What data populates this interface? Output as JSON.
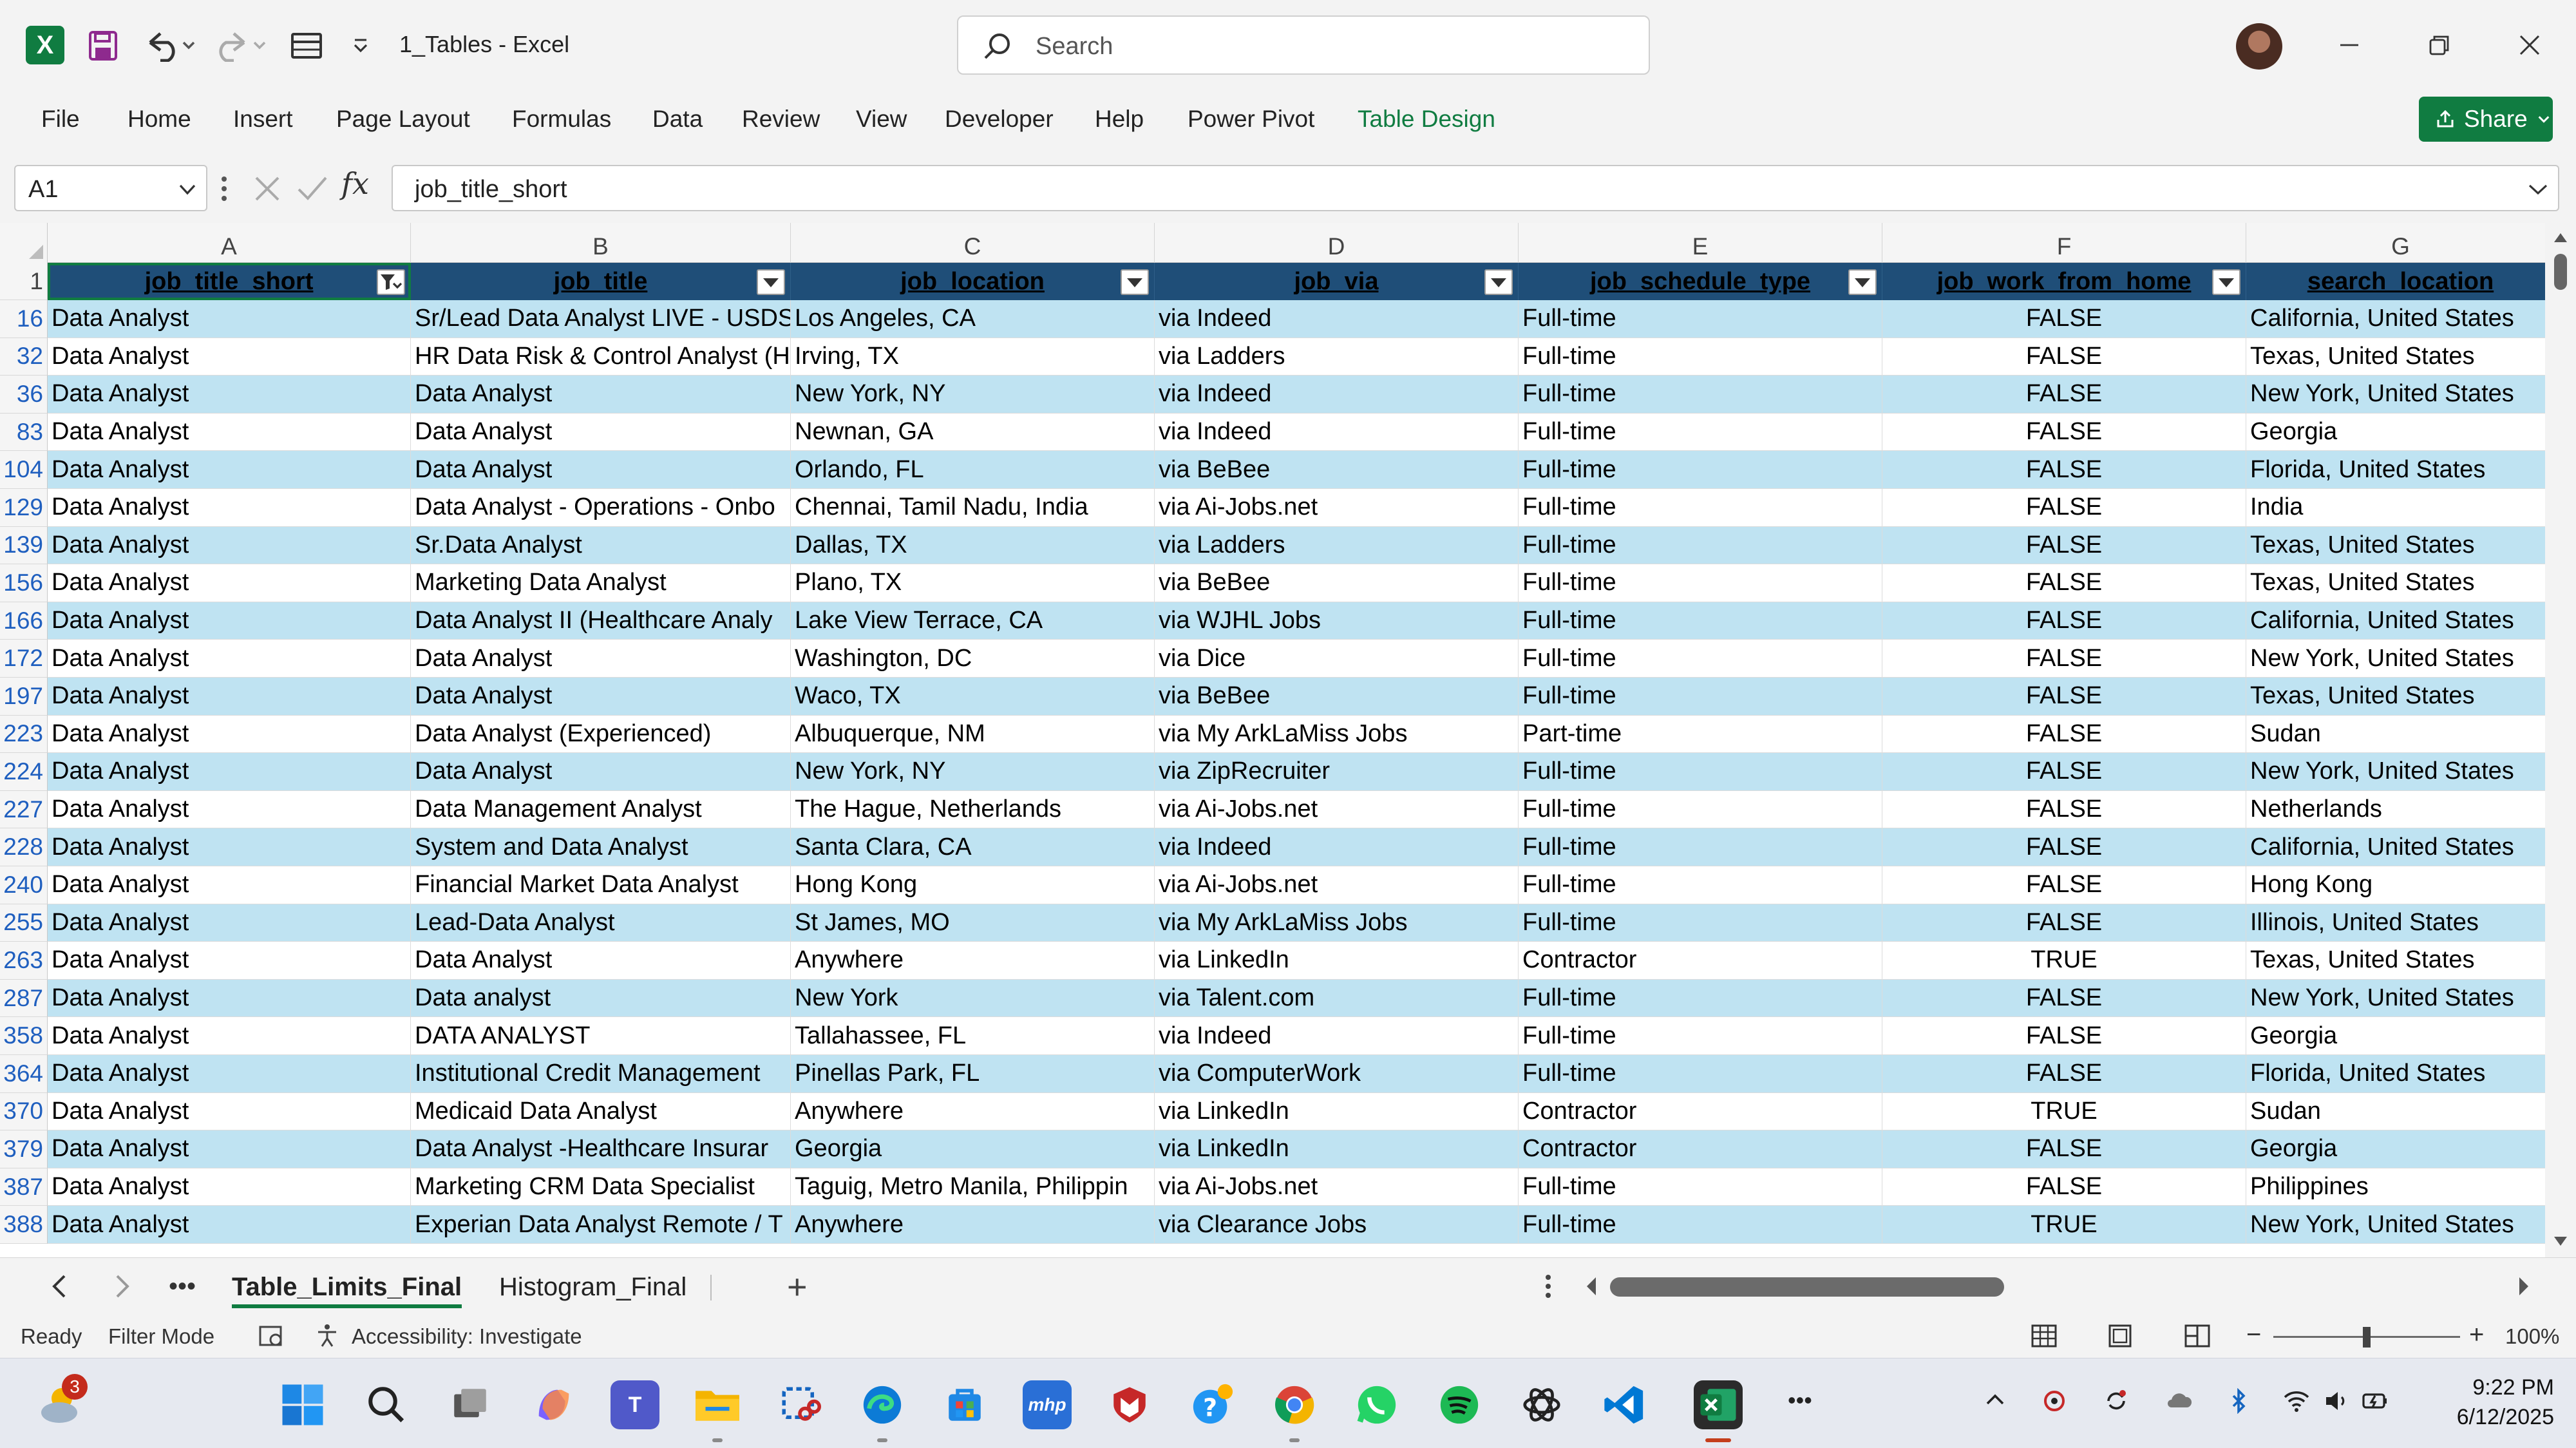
{
  "window": {
    "title": "1_Tables  -  Excel",
    "search_placeholder": "Search"
  },
  "ribbon": {
    "tabs": [
      "File",
      "Home",
      "Insert",
      "Page Layout",
      "Formulas",
      "Data",
      "Review",
      "View",
      "Developer",
      "Help",
      "Power Pivot",
      "Table Design"
    ],
    "active_tab": "Table Design",
    "share_label": "Share",
    "accent_color": "#107c41"
  },
  "formula_bar": {
    "name_box": "A1",
    "fx_label": "fx",
    "content": "job_title_short"
  },
  "grid": {
    "column_letters": [
      "A",
      "B",
      "C",
      "D",
      "E",
      "F",
      "G"
    ],
    "header_row_number": "1",
    "headers": [
      "job_title_short",
      "job_title",
      "job_location",
      "job_via",
      "job_schedule_type",
      "job_work_from_home",
      "search_location"
    ],
    "header_color": "#1f4e78",
    "band_color": "#bfe3f2",
    "rows": [
      {
        "n": "16",
        "c": [
          "Data Analyst",
          "Sr/Lead Data Analyst LIVE - USDS",
          "Los Angeles, CA",
          "via Indeed",
          "Full-time",
          "FALSE",
          "California, United States"
        ]
      },
      {
        "n": "32",
        "c": [
          "Data Analyst",
          "HR Data Risk & Control Analyst (H",
          "Irving, TX",
          "via Ladders",
          "Full-time",
          "FALSE",
          "Texas, United States"
        ]
      },
      {
        "n": "36",
        "c": [
          "Data Analyst",
          "Data Analyst",
          "New York, NY",
          "via Indeed",
          "Full-time",
          "FALSE",
          "New York, United States"
        ]
      },
      {
        "n": "83",
        "c": [
          "Data Analyst",
          "Data Analyst",
          "Newnan, GA",
          "via Indeed",
          "Full-time",
          "FALSE",
          "Georgia"
        ]
      },
      {
        "n": "104",
        "c": [
          "Data Analyst",
          "Data Analyst",
          "Orlando, FL",
          "via BeBee",
          "Full-time",
          "FALSE",
          "Florida, United States"
        ]
      },
      {
        "n": "129",
        "c": [
          "Data Analyst",
          "Data Analyst - Operations - Onbo",
          "Chennai, Tamil Nadu, India",
          "via Ai-Jobs.net",
          "Full-time",
          "FALSE",
          "India"
        ]
      },
      {
        "n": "139",
        "c": [
          "Data Analyst",
          "Sr.Data Analyst",
          "Dallas, TX",
          "via Ladders",
          "Full-time",
          "FALSE",
          "Texas, United States"
        ]
      },
      {
        "n": "156",
        "c": [
          "Data Analyst",
          "Marketing Data Analyst",
          "Plano, TX",
          "via BeBee",
          "Full-time",
          "FALSE",
          "Texas, United States"
        ]
      },
      {
        "n": "166",
        "c": [
          "Data Analyst",
          "Data Analyst II (Healthcare Analy",
          "Lake View Terrace, CA",
          "via WJHL Jobs",
          "Full-time",
          "FALSE",
          "California, United States"
        ]
      },
      {
        "n": "172",
        "c": [
          "Data Analyst",
          "Data Analyst",
          "Washington, DC",
          "via Dice",
          "Full-time",
          "FALSE",
          "New York, United States"
        ]
      },
      {
        "n": "197",
        "c": [
          "Data Analyst",
          "Data Analyst",
          "Waco, TX",
          "via BeBee",
          "Full-time",
          "FALSE",
          "Texas, United States"
        ]
      },
      {
        "n": "223",
        "c": [
          "Data Analyst",
          "Data Analyst (Experienced)",
          "Albuquerque, NM",
          "via My ArkLaMiss Jobs",
          "Part-time",
          "FALSE",
          "Sudan"
        ]
      },
      {
        "n": "224",
        "c": [
          "Data Analyst",
          "Data Analyst",
          "New York, NY",
          "via ZipRecruiter",
          "Full-time",
          "FALSE",
          "New York, United States"
        ]
      },
      {
        "n": "227",
        "c": [
          "Data Analyst",
          "Data Management Analyst",
          "The Hague, Netherlands",
          "via Ai-Jobs.net",
          "Full-time",
          "FALSE",
          "Netherlands"
        ]
      },
      {
        "n": "228",
        "c": [
          "Data Analyst",
          "System and Data Analyst",
          "Santa Clara, CA",
          "via Indeed",
          "Full-time",
          "FALSE",
          "California, United States"
        ]
      },
      {
        "n": "240",
        "c": [
          "Data Analyst",
          "Financial Market Data Analyst",
          "Hong Kong",
          "via Ai-Jobs.net",
          "Full-time",
          "FALSE",
          "Hong Kong"
        ]
      },
      {
        "n": "255",
        "c": [
          "Data Analyst",
          "Lead-Data Analyst",
          "St James, MO",
          "via My ArkLaMiss Jobs",
          "Full-time",
          "FALSE",
          "Illinois, United States"
        ]
      },
      {
        "n": "263",
        "c": [
          "Data Analyst",
          "Data Analyst",
          "Anywhere",
          "via LinkedIn",
          "Contractor",
          "TRUE",
          "Texas, United States"
        ]
      },
      {
        "n": "287",
        "c": [
          "Data Analyst",
          "Data analyst",
          "New York",
          "via Talent.com",
          "Full-time",
          "FALSE",
          "New York, United States"
        ]
      },
      {
        "n": "358",
        "c": [
          "Data Analyst",
          "DATA ANALYST",
          "Tallahassee, FL",
          "via Indeed",
          "Full-time",
          "FALSE",
          "Georgia"
        ]
      },
      {
        "n": "364",
        "c": [
          "Data Analyst",
          "Institutional Credit Management",
          "Pinellas Park, FL",
          "via ComputerWork",
          "Full-time",
          "FALSE",
          "Florida, United States"
        ]
      },
      {
        "n": "370",
        "c": [
          "Data Analyst",
          "Medicaid Data Analyst",
          "Anywhere",
          "via LinkedIn",
          "Contractor",
          "TRUE",
          "Sudan"
        ]
      },
      {
        "n": "379",
        "c": [
          "Data Analyst",
          "Data Analyst -Healthcare Insurar",
          "Georgia",
          "via LinkedIn",
          "Contractor",
          "FALSE",
          "Georgia"
        ]
      },
      {
        "n": "387",
        "c": [
          "Data Analyst",
          "Marketing CRM Data Specialist",
          "Taguig, Metro Manila, Philippin",
          "via Ai-Jobs.net",
          "Full-time",
          "FALSE",
          "Philippines"
        ]
      },
      {
        "n": "388",
        "c": [
          "Data Analyst",
          "Experian Data Analyst Remote / T",
          "Anywhere",
          "via Clearance Jobs",
          "Full-time",
          "TRUE",
          "New York, United States"
        ]
      }
    ]
  },
  "sheets": {
    "tabs": [
      "Table_Limits_Final",
      "Histogram_Final"
    ],
    "active": "Table_Limits_Final",
    "more": "•••",
    "add": "+"
  },
  "status": {
    "ready": "Ready",
    "mode": "Filter Mode",
    "accessibility": "Accessibility: Investigate",
    "zoom": "100%",
    "zoom_minus": "−",
    "zoom_plus": "+",
    "zoom_level": 0.5
  },
  "taskbar": {
    "weather_badge": "3",
    "time": "9:22 PM",
    "date": "6/12/2025",
    "more": "•••",
    "apps": [
      "start-icon",
      "search-icon",
      "task-view-icon",
      "copilot-icon",
      "teams-icon",
      "file-explorer-icon",
      "snipping-tool-icon",
      "edge-icon",
      "microsoft-store-icon",
      "mhp-app-icon",
      "mcafee-icon",
      "help-icon",
      "chrome-icon",
      "whatsapp-icon",
      "spotify-icon",
      "chatgpt-icon",
      "vscode-icon",
      "excel-icon"
    ]
  }
}
